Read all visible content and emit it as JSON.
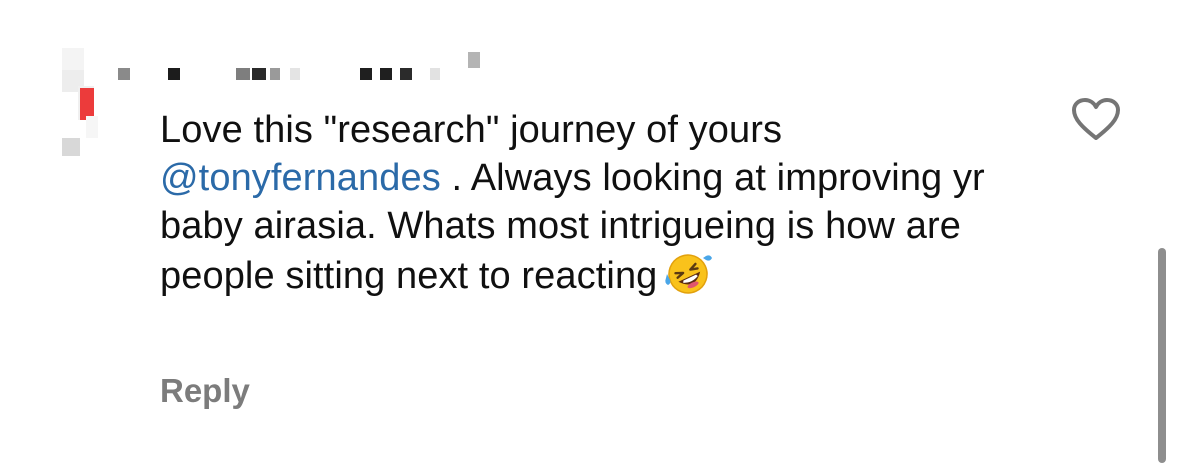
{
  "comment": {
    "text_before_mention": "Love this \"research\" journey of yours",
    "mention": "@tonyfernandes",
    "text_after_mention": " . Always looking at improving yr baby airasia. Whats most intrigueing is how are people sitting next to reacting",
    "emoji": "rolling-on-the-floor-laughing"
  },
  "actions": {
    "reply_label": "Reply",
    "like_icon": "heart-outline-icon"
  },
  "colors": {
    "mention": "#2b6aa8",
    "reply": "#7c7c7c",
    "text": "#101010"
  }
}
